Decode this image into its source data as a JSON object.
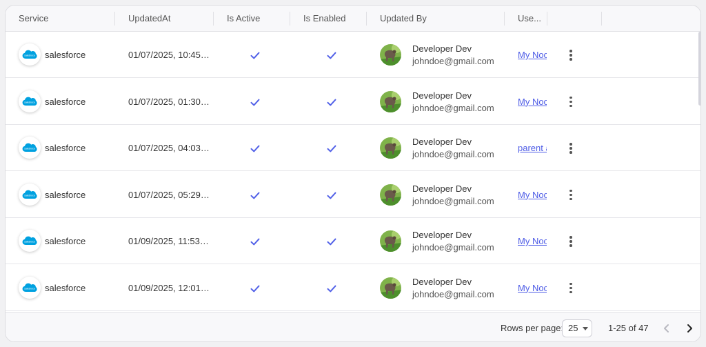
{
  "columns": {
    "service": "Service",
    "updated_at": "UpdatedAt",
    "is_active": "Is Active",
    "is_enabled": "Is Enabled",
    "updated_by": "Updated By",
    "use": "Use..."
  },
  "rows": [
    {
      "service": "salesforce",
      "updated_at": "01/07/2025, 10:45 ...",
      "is_active": true,
      "is_enabled": true,
      "user_name": "Developer Dev",
      "user_email": "johndoe@gmail.com",
      "link": "My Noc"
    },
    {
      "service": "salesforce",
      "updated_at": "01/07/2025, 01:30 ...",
      "is_active": true,
      "is_enabled": true,
      "user_name": "Developer Dev",
      "user_email": "johndoe@gmail.com",
      "link": "My Noc"
    },
    {
      "service": "salesforce",
      "updated_at": "01/07/2025, 04:03 ...",
      "is_active": true,
      "is_enabled": true,
      "user_name": "Developer Dev",
      "user_email": "johndoe@gmail.com",
      "link": "parent a"
    },
    {
      "service": "salesforce",
      "updated_at": "01/07/2025, 05:29 ...",
      "is_active": true,
      "is_enabled": true,
      "user_name": "Developer Dev",
      "user_email": "johndoe@gmail.com",
      "link": "My Noc"
    },
    {
      "service": "salesforce",
      "updated_at": "01/09/2025, 11:53 A...",
      "is_active": true,
      "is_enabled": true,
      "user_name": "Developer Dev",
      "user_email": "johndoe@gmail.com",
      "link": "My Noc"
    },
    {
      "service": "salesforce",
      "updated_at": "01/09/2025, 12:01 P...",
      "is_active": true,
      "is_enabled": true,
      "user_name": "Developer Dev",
      "user_email": "johndoe@gmail.com",
      "link": "My Noc"
    }
  ],
  "pagination": {
    "rows_per_page_label": "Rows per page:",
    "rows_per_page_value": "25",
    "range_text": "1-25 of 47"
  },
  "icons": {
    "row_logo": "salesforce-logo-icon",
    "check": "check-icon",
    "avatar": "user-avatar",
    "row_menu": "more-vertical-icon",
    "prev": "chevron-left-icon",
    "next": "chevron-right-icon",
    "select_arrow": "caret-down-icon"
  },
  "colors": {
    "accent": "#4e5ce6",
    "salesforce_blue": "#00a1e0"
  }
}
